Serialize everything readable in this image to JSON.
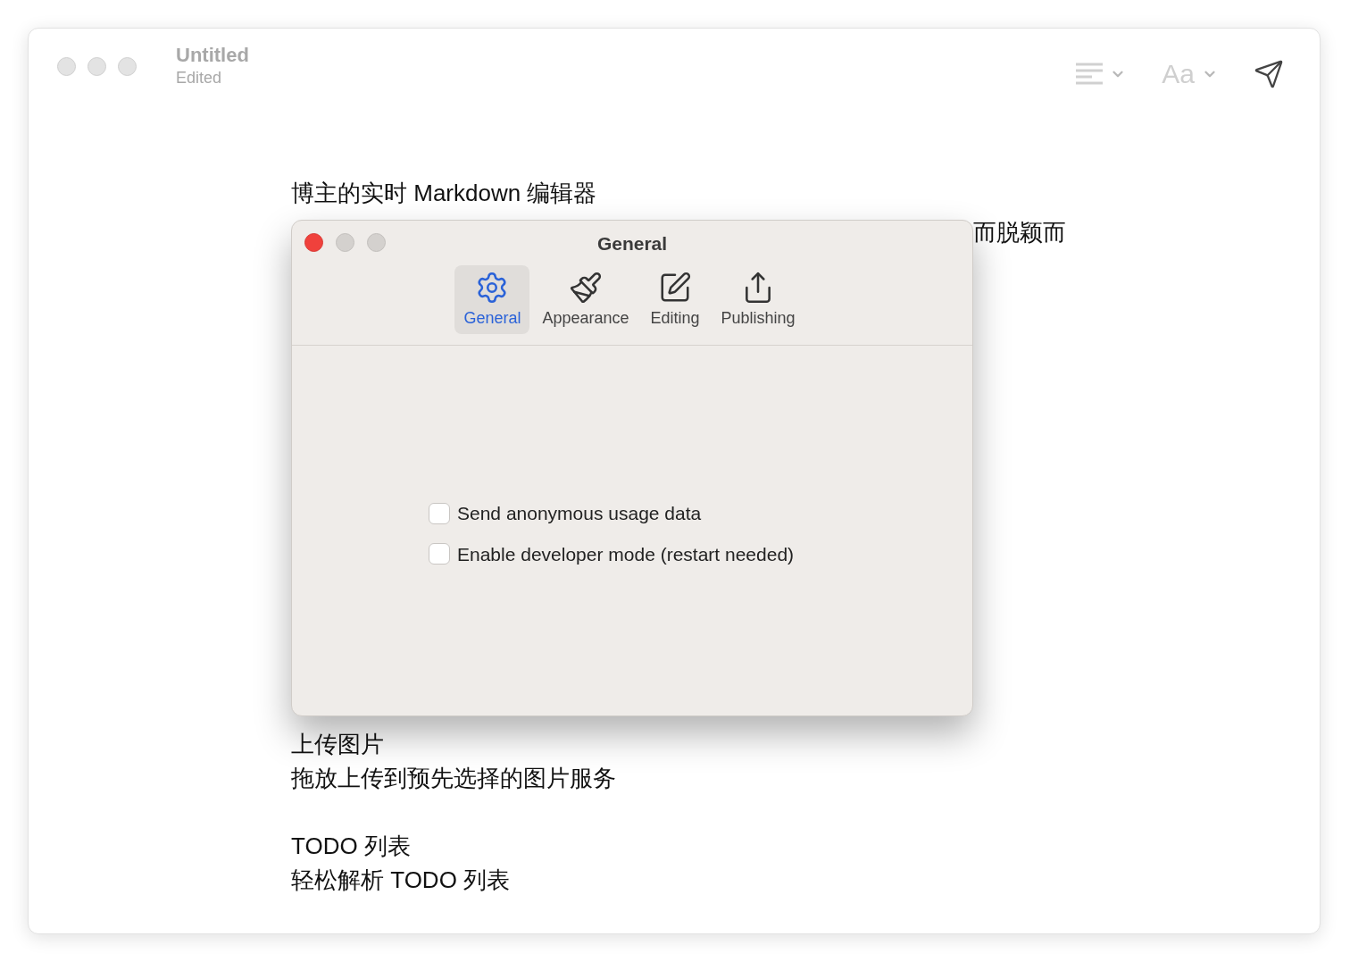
{
  "window": {
    "title": "Untitled",
    "subtitle": "Edited",
    "font_button": "Aa"
  },
  "document": {
    "heading_line": "博主的实时 Markdown 编辑器",
    "right_fragment": "而脱颖而",
    "paragraphs_below": [
      [
        "上传图片",
        "拖放上传到预先选择的图片服务"
      ],
      [
        "TODO 列表",
        "轻松解析 TODO 列表"
      ]
    ]
  },
  "dialog": {
    "title": "General",
    "tabs": [
      {
        "label": "General",
        "kind": "gear",
        "selected": true
      },
      {
        "label": "Appearance",
        "kind": "brush",
        "selected": false
      },
      {
        "label": "Editing",
        "kind": "edit",
        "selected": false
      },
      {
        "label": "Publishing",
        "kind": "share",
        "selected": false
      }
    ],
    "options": [
      {
        "label": "Send anonymous usage data",
        "checked": false
      },
      {
        "label": "Enable developer mode (restart needed)",
        "checked": false
      }
    ]
  }
}
